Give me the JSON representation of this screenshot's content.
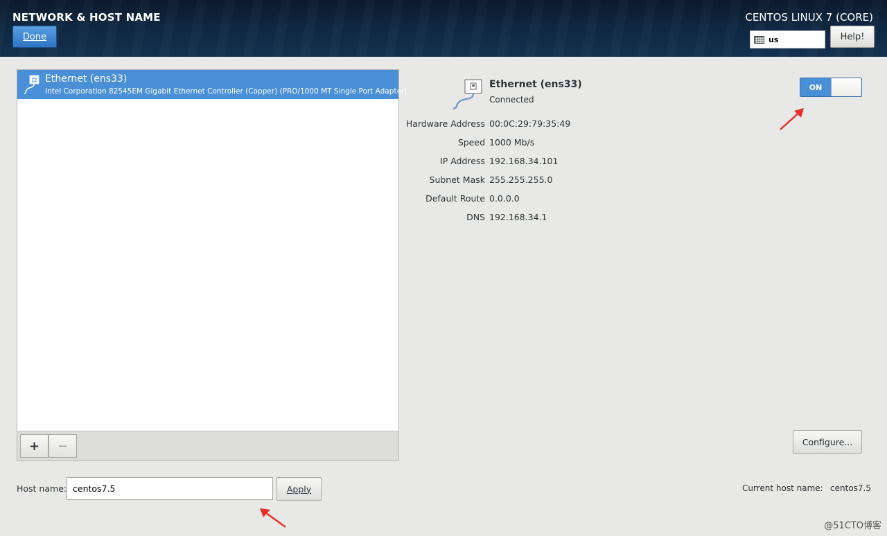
{
  "header": {
    "title": "NETWORK & HOST NAME",
    "done_label": "Done",
    "product": "CENTOS LINUX 7 (CORE)",
    "keyboard_layout": "us",
    "help_label": "Help!"
  },
  "devices": [
    {
      "name": "Ethernet (ens33)",
      "description": "Intel Corporation 82545EM Gigabit Ethernet Controller (Copper) (PRO/1000 MT Single Port Adapter)",
      "selected": true
    }
  ],
  "toolbar": {
    "add_label": "+",
    "remove_label": "−"
  },
  "details": {
    "name": "Ethernet (ens33)",
    "status": "Connected",
    "toggle_label": "ON",
    "toggle_state": "on",
    "properties": [
      {
        "label": "Hardware Address",
        "value": "00:0C:29:79:35:49"
      },
      {
        "label": "Speed",
        "value": "1000 Mb/s"
      },
      {
        "label": "IP Address",
        "value": "192.168.34.101"
      },
      {
        "label": "Subnet Mask",
        "value": "255.255.255.0"
      },
      {
        "label": "Default Route",
        "value": "0.0.0.0"
      },
      {
        "label": "DNS",
        "value": "192.168.34.1"
      }
    ],
    "configure_label": "Configure..."
  },
  "hostname": {
    "label": "Host name:",
    "value": "centos7.5",
    "apply_label": "Apply",
    "current_label": "Current host name:",
    "current_value": "centos7.5"
  },
  "watermark": "@51CTO博客",
  "colors": {
    "accent": "#4a90d9",
    "header_bg": "#0f2740",
    "annotation_arrow": "#e8312a"
  }
}
